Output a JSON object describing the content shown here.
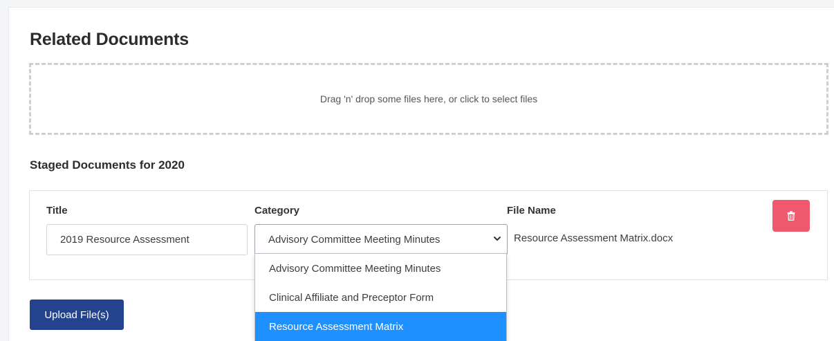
{
  "section": {
    "title": "Related Documents"
  },
  "dropzone": {
    "text": "Drag 'n' drop some files here, or click to select files"
  },
  "staged": {
    "title": "Staged Documents for 2020",
    "columns": {
      "title": "Title",
      "category": "Category",
      "file_name": "File Name"
    },
    "row": {
      "title_value": "2019 Resource Assessment",
      "category_value": "Advisory Committee Meeting Minutes",
      "file_name": "Resource Assessment Matrix.docx"
    }
  },
  "category_options": [
    "Advisory Committee Meeting Minutes",
    "Clinical Affiliate and Preceptor Form",
    "Resource Assessment Matrix"
  ],
  "highlighted_option": "Resource Assessment Matrix",
  "buttons": {
    "upload_label": "Upload File(s)",
    "delete_icon": "trash-icon"
  },
  "colors": {
    "upload_button": "#24438f",
    "delete_button": "#f0586e",
    "highlight": "#1e90ff"
  }
}
